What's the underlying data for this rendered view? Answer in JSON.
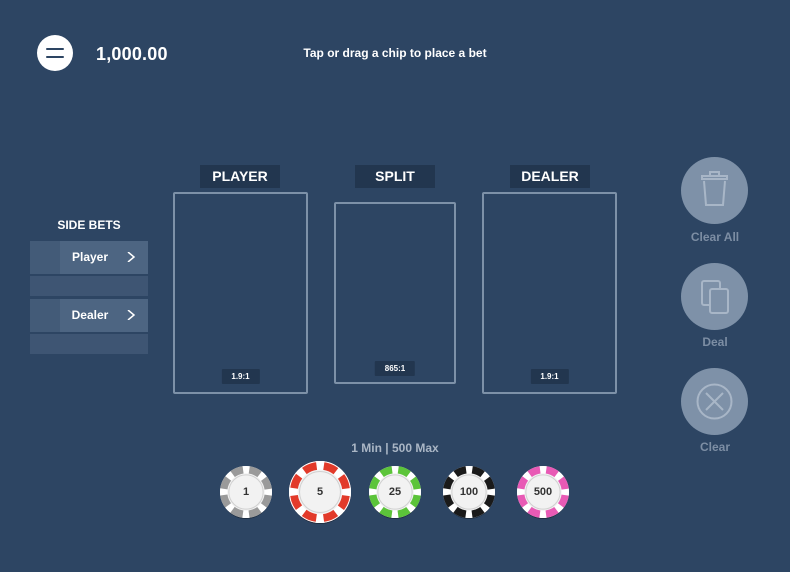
{
  "header": {
    "balance": "1,000.00",
    "instruction": "Tap or drag a chip to place a bet",
    "menu_icon": "hamburger-menu-icon"
  },
  "side_bets": {
    "title": "SIDE BETS",
    "items": [
      {
        "label": "Player"
      },
      {
        "label": "Dealer"
      }
    ]
  },
  "bet_areas": [
    {
      "label": "PLAYER",
      "odds": "1.9:1"
    },
    {
      "label": "SPLIT",
      "odds": "865:1"
    },
    {
      "label": "DEALER",
      "odds": "1.9:1"
    }
  ],
  "controls": [
    {
      "label": "Clear All",
      "icon": "trash-icon"
    },
    {
      "label": "Deal",
      "icon": "cards-icon"
    },
    {
      "label": "Clear",
      "icon": "close-circle-icon"
    }
  ],
  "limits": "1 Min | 500 Max",
  "chips": [
    {
      "value": "1",
      "color": "#9a9a9a",
      "selected": false
    },
    {
      "value": "5",
      "color": "#e23a2a",
      "selected": true
    },
    {
      "value": "25",
      "color": "#5cc43a",
      "selected": false
    },
    {
      "value": "100",
      "color": "#1a1a1a",
      "selected": false
    },
    {
      "value": "500",
      "color": "#e85ab5",
      "selected": false
    }
  ],
  "colors": {
    "background": "#2d4563",
    "label_bg": "#22364f",
    "box_border": "#7d91a8",
    "control_disabled": "#7e91a8"
  }
}
